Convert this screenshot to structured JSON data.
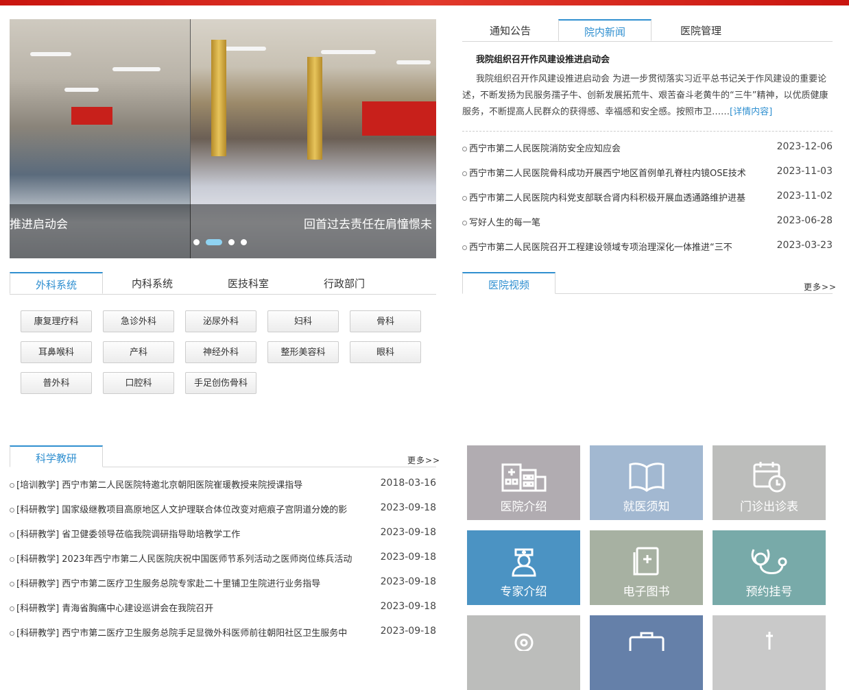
{
  "slider": {
    "captions": [
      "推进启动会",
      "回首过去责任在肩憧憬未"
    ],
    "dots": 4
  },
  "news_tabs": [
    "通知公告",
    "院内新闻",
    "医院管理"
  ],
  "news": {
    "headline": "我院组织召开作风建设推进启动会",
    "summary": "我院组织召开作风建设推进启动会 为进一步贯彻落实习近平总书记关于作风建设的重要论述，不断发扬为民服务孺子牛、创新发展拓荒牛、艰苦奋斗老黄牛的“三牛”精神，以优质健康服务，不断提高人民群众的获得感、幸福感和安全感。按照市卫……",
    "detail_link": "[详情内容]",
    "items": [
      {
        "title": "西宁市第二人民医院消防安全应知应会",
        "date": "2023-12-06"
      },
      {
        "title": "西宁市第二人民医院骨科成功开展西宁地区首例单孔脊柱内镜OSE技术",
        "date": "2023-11-03"
      },
      {
        "title": "西宁市第二人民医院内科党支部联合肾内科积极开展血透通路维护进基",
        "date": "2023-11-02"
      },
      {
        "title": "写好人生的每一笔",
        "date": "2023-06-28"
      },
      {
        "title": "西宁市第二人民医院召开工程建设领域专项治理深化一体推进“三不",
        "date": "2023-03-23"
      }
    ]
  },
  "dept_tabs": [
    "外科系统",
    "内科系统",
    "医技科室",
    "行政部门"
  ],
  "departments": [
    "康复理疗科",
    "急诊外科",
    "泌尿外科",
    "妇科",
    "骨科",
    "耳鼻喉科",
    "产科",
    "神经外科",
    "整形美容科",
    "眼科",
    "普外科",
    "口腔科",
    "手足创伤骨科"
  ],
  "video": {
    "tab": "医院视频",
    "more": "更多>>"
  },
  "research": {
    "tab": "科学教研",
    "more": "更多>>",
    "items": [
      {
        "title": "[培训教学] 西宁市第二人民医院特邀北京朝阳医院崔瑗教授来院授课指导",
        "date": "2018-03-16"
      },
      {
        "title": "[科研教学] 国家级继教项目高原地区人文护理联合体位改变对疤痕子宫阴道分娩的影",
        "date": "2023-09-18"
      },
      {
        "title": "[科研教学] 省卫健委领导莅临我院调研指导助培教学工作",
        "date": "2023-09-18"
      },
      {
        "title": "[科研教学] 2023年西宁市第二人民医院庆祝中国医师节系列活动之医师岗位练兵活动",
        "date": "2023-09-18"
      },
      {
        "title": "[科研教学] 西宁市第二医疗卫生服务总院专家赴二十里铺卫生院进行业务指导",
        "date": "2023-09-18"
      },
      {
        "title": "[科研教学] 青海省胸痛中心建设巡讲会在我院召开",
        "date": "2023-09-18"
      },
      {
        "title": "[科研教学] 西宁市第二医疗卫生服务总院手足显微外科医师前往朝阳社区卫生服务中",
        "date": "2023-09-18"
      }
    ]
  },
  "tiles": [
    {
      "label": "医院介绍",
      "color": "#b1acb1",
      "icon": "hospital-icon"
    },
    {
      "label": "就医须知",
      "color": "#a2b8d1",
      "icon": "book-icon"
    },
    {
      "label": "门诊出诊表",
      "color": "#bcbdbb",
      "icon": "calendar-clock-icon"
    },
    {
      "label": "专家介绍",
      "color": "#4b93c3",
      "icon": "nurse-icon"
    },
    {
      "label": "电子图书",
      "color": "#a7b1a2",
      "icon": "medical-book-icon"
    },
    {
      "label": "预约挂号",
      "color": "#78aaa9",
      "icon": "stethoscope-icon"
    },
    {
      "label": "",
      "color": "#bcbdbb",
      "icon": "pill-icon"
    },
    {
      "label": "",
      "color": "#6580a9",
      "icon": "medical-kit-icon"
    },
    {
      "label": "",
      "color": "#c9c9c9",
      "icon": "syringe-icon"
    }
  ]
}
